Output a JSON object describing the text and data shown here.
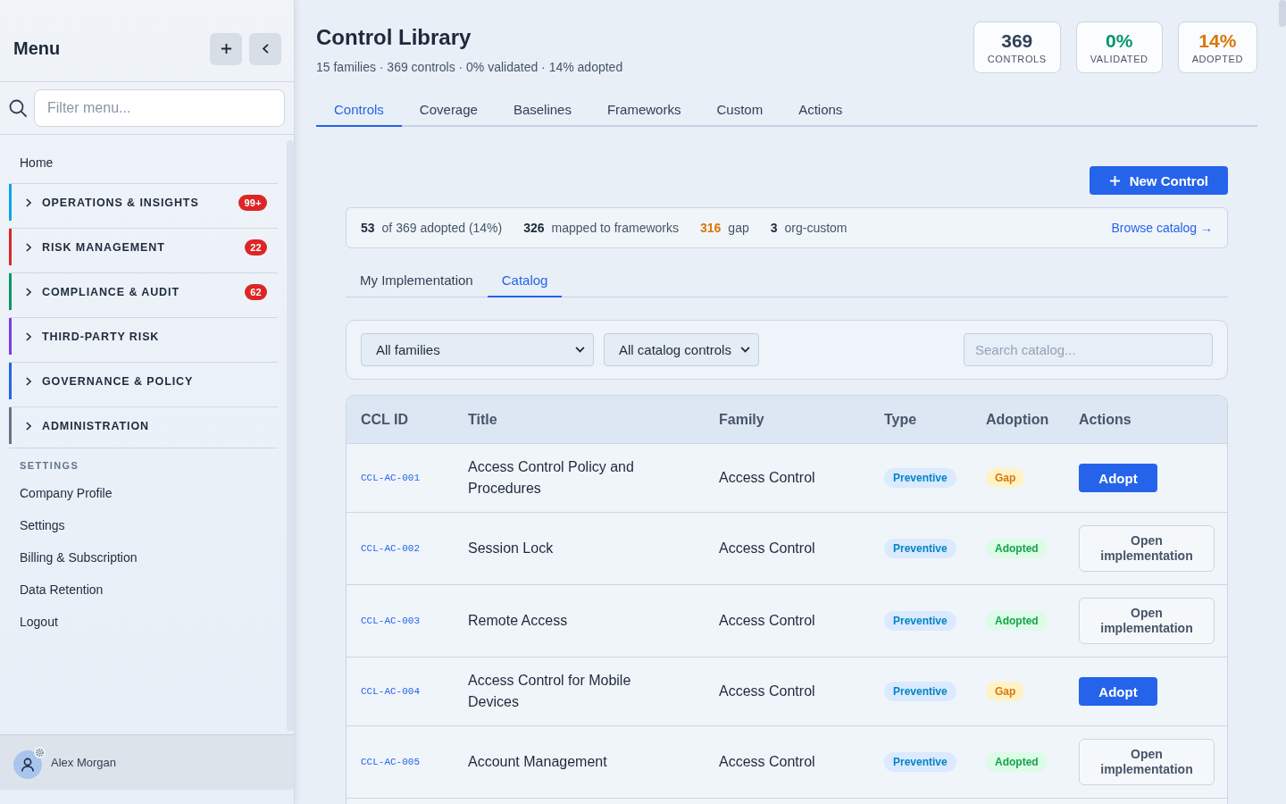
{
  "sidebar": {
    "title": "Menu",
    "search": {
      "placeholder": "Filter menu..."
    },
    "items": [
      {
        "kind": "link",
        "label": "Home"
      },
      {
        "kind": "group",
        "label": "OPERATIONS & INSIGHTS",
        "expanded": false,
        "color": "#0ea5e9",
        "badge": "99+"
      },
      {
        "kind": "group",
        "label": "RISK MANAGEMENT",
        "expanded": false,
        "color": "#dc2626",
        "badge": "22"
      },
      {
        "kind": "group",
        "label": "COMPLIANCE & AUDIT",
        "expanded": false,
        "color": "#059669",
        "badge": "62"
      },
      {
        "kind": "group",
        "label": "THIRD-PARTY RISK",
        "expanded": false,
        "color": "#7c3aed"
      },
      {
        "kind": "group",
        "label": "GOVERNANCE & POLICY",
        "expanded": false,
        "color": "#2563eb"
      },
      {
        "kind": "group",
        "label": "ADMINISTRATION",
        "expanded": false,
        "color": "#64748b"
      }
    ],
    "settings": {
      "heading": "SETTINGS",
      "items": [
        "Company Profile",
        "Settings",
        "Billing & Subscription",
        "Data Retention",
        "Logout"
      ]
    },
    "user": {
      "name": "Alex Morgan"
    }
  },
  "page": {
    "title": "Control Library",
    "subtitle": "15 families · 369 controls · 0% validated · 14% adopted",
    "stats": [
      {
        "value": "369",
        "label": "CONTROLS",
        "color": "#334155"
      },
      {
        "value": "0%",
        "label": "VALIDATED",
        "color": "#059669"
      },
      {
        "value": "14%",
        "label": "ADOPTED",
        "color": "#d97706"
      }
    ]
  },
  "tabs": [
    {
      "label": "Controls",
      "selected": true
    },
    {
      "label": "Coverage",
      "selected": false
    },
    {
      "label": "Baselines",
      "selected": false
    },
    {
      "label": "Frameworks",
      "selected": false
    },
    {
      "label": "Custom",
      "selected": false
    },
    {
      "label": "Actions",
      "selected": false
    }
  ],
  "new_control_button": "New Control",
  "summary": {
    "items": [
      {
        "value": "53",
        "text": "of 369 adopted (14%)",
        "color": "#1e293b"
      },
      {
        "value": "326",
        "text": "mapped to frameworks",
        "color": "#1e293b"
      },
      {
        "value": "316",
        "text": "gap",
        "color": "#d97706"
      },
      {
        "value": "3",
        "text": "org-custom",
        "color": "#1e293b"
      }
    ],
    "link": "Browse catalog →"
  },
  "subtabs": [
    {
      "label": "My Implementation",
      "selected": false
    },
    {
      "label": "Catalog",
      "selected": true
    }
  ],
  "filters": {
    "selects": [
      {
        "value": "All families"
      },
      {
        "value": "All catalog controls"
      }
    ],
    "search": {
      "placeholder": "Search catalog..."
    }
  },
  "table": {
    "columns": [
      "CCL ID",
      "Title",
      "Family",
      "Type",
      "Adoption",
      "Actions"
    ],
    "rows": [
      {
        "ccl_id": "CCL-AC-001",
        "title": "Access Control Policy and Procedures",
        "family": "Access Control",
        "type": "Preventive",
        "adoption": {
          "label": "Gap",
          "kind": "gap"
        },
        "action": {
          "label": "Adopt",
          "kind": "primary"
        }
      },
      {
        "ccl_id": "CCL-AC-002",
        "title": "Session Lock",
        "family": "Access Control",
        "type": "Preventive",
        "adoption": {
          "label": "Adopted",
          "kind": "adopted"
        },
        "action": {
          "label": "Open implementation",
          "kind": "secondary"
        }
      },
      {
        "ccl_id": "CCL-AC-003",
        "title": "Remote Access",
        "family": "Access Control",
        "type": "Preventive",
        "adoption": {
          "label": "Adopted",
          "kind": "adopted"
        },
        "action": {
          "label": "Open implementation",
          "kind": "secondary"
        }
      },
      {
        "ccl_id": "CCL-AC-004",
        "title": "Access Control for Mobile Devices",
        "family": "Access Control",
        "type": "Preventive",
        "adoption": {
          "label": "Gap",
          "kind": "gap"
        },
        "action": {
          "label": "Adopt",
          "kind": "primary"
        }
      },
      {
        "ccl_id": "CCL-AC-005",
        "title": "Account Management",
        "family": "Access Control",
        "type": "Preventive",
        "adoption": {
          "label": "Adopted",
          "kind": "adopted"
        },
        "action": {
          "label": "Open implementation",
          "kind": "secondary"
        }
      }
    ]
  }
}
